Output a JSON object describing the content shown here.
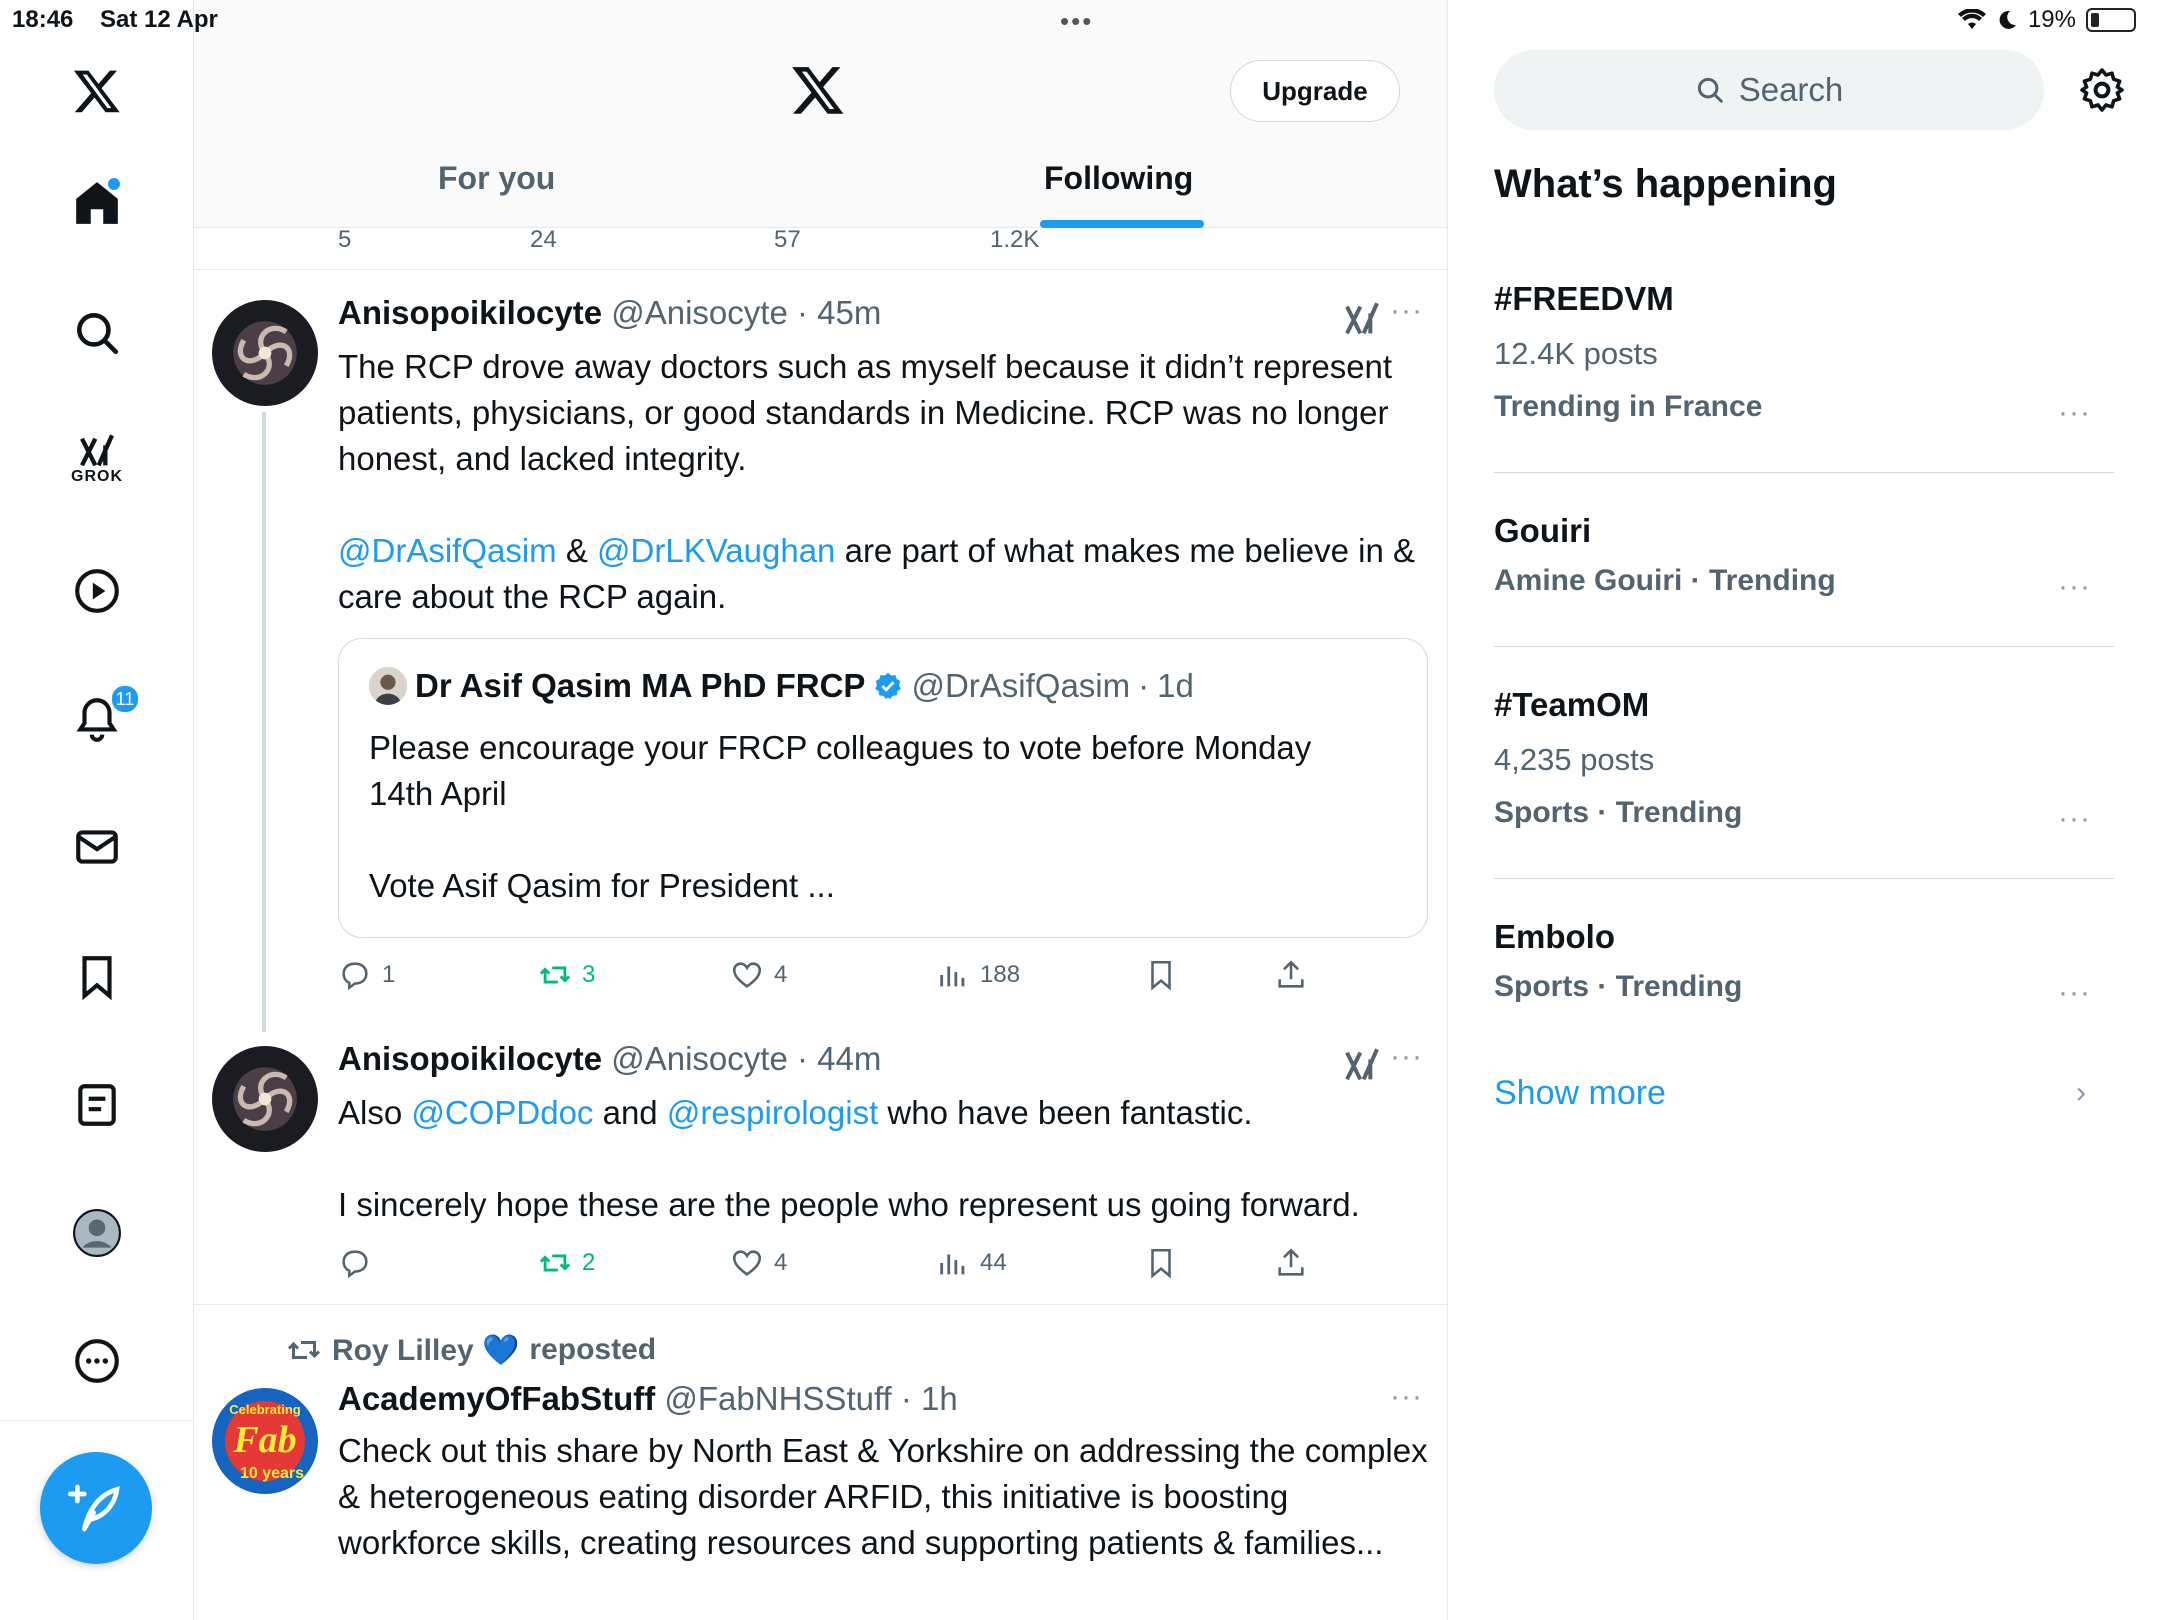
{
  "status_bar": {
    "time": "18:46",
    "date": "Sat 12 Apr",
    "battery": "19%"
  },
  "nav": {
    "items": [
      {
        "name": "home",
        "icon": "home-icon"
      },
      {
        "name": "explore",
        "icon": "search-icon"
      },
      {
        "name": "grok",
        "icon": "grok-icon",
        "label": "GROK"
      },
      {
        "name": "video",
        "icon": "play-icon"
      },
      {
        "name": "notifications",
        "icon": "bell-icon",
        "badge": "11"
      },
      {
        "name": "messages",
        "icon": "mail-icon"
      },
      {
        "name": "bookmarks",
        "icon": "bookmark-icon"
      },
      {
        "name": "lists",
        "icon": "list-icon"
      },
      {
        "name": "profile",
        "icon": "avatar-icon"
      },
      {
        "name": "more",
        "icon": "more-circle-icon"
      }
    ],
    "compose_icon": "compose-icon"
  },
  "header": {
    "upgrade_label": "Upgrade",
    "tabs": [
      {
        "label": "For you",
        "active": false
      },
      {
        "label": "Following",
        "active": true
      }
    ]
  },
  "prev_tweet_actions": {
    "replies": "5",
    "reposts": "24",
    "likes": "57",
    "views": "1.2K"
  },
  "tweets": [
    {
      "name": "Anisopoikilocyte",
      "handle": "@Anisocyte",
      "time": "45m",
      "text_p1": "The RCP drove away doctors such as myself because it didn’t represent patients, physicians, or good standards in Medicine. RCP was no longer honest, and lacked integrity.",
      "mention1": "@DrAsifQasim",
      "amp": " & ",
      "mention2": "@DrLKVaughan",
      "text_p2_tail": " are part of what makes me believe in & care about the RCP again.",
      "quote": {
        "name": "Dr Asif Qasim MA PhD FRCP",
        "handle": "@DrAsifQasim",
        "time": "1d",
        "p1": "Please encourage your FRCP colleagues to vote before Monday 14th April",
        "p2": "Vote Asif Qasim for President ..."
      },
      "actions": {
        "replies": "1",
        "reposts": "3",
        "likes": "4",
        "views": "188"
      }
    },
    {
      "name": "Anisopoikilocyte",
      "handle": "@Anisocyte",
      "time": "44m",
      "text_a": "Also ",
      "mention1": "@COPDdoc",
      "text_b": " and ",
      "mention2": "@respirologist",
      "text_c": " who have been fantastic.",
      "text_p2": "I sincerely hope these are the people who represent us going forward.",
      "actions": {
        "replies": "",
        "reposts": "2",
        "likes": "4",
        "views": "44"
      }
    },
    {
      "repost_by": "Roy Lilley 💙",
      "repost_label": "reposted",
      "name": "AcademyOfFabStuff",
      "handle": "@FabNHSStuff",
      "time": "1h",
      "avatar_text_top": "Celebrating",
      "avatar_text_mid": "Fab",
      "avatar_text_bottom": "10 years",
      "text": "Check out this share by North East & Yorkshire on addressing the complex & heterogeneous eating disorder ARFID, this initiative is boosting workforce skills, creating resources and supporting patients & families..."
    }
  ],
  "right": {
    "search_placeholder": "Search",
    "section_title": "What’s happening",
    "trends": [
      {
        "title": "#FREEDVM",
        "posts": "12.4K posts",
        "category": "Trending in France"
      },
      {
        "title": "Gouiri",
        "posts": "",
        "category": "Amine Gouiri · Trending"
      },
      {
        "title": "#TeamOM",
        "posts": "4,235 posts",
        "category": "Sports · Trending"
      },
      {
        "title": "Embolo",
        "posts": "",
        "category": "Sports · Trending"
      }
    ],
    "show_more": "Show more"
  },
  "colors": {
    "accent": "#1d9bf0",
    "retweet": "#00ba7c",
    "muted": "#536471"
  }
}
